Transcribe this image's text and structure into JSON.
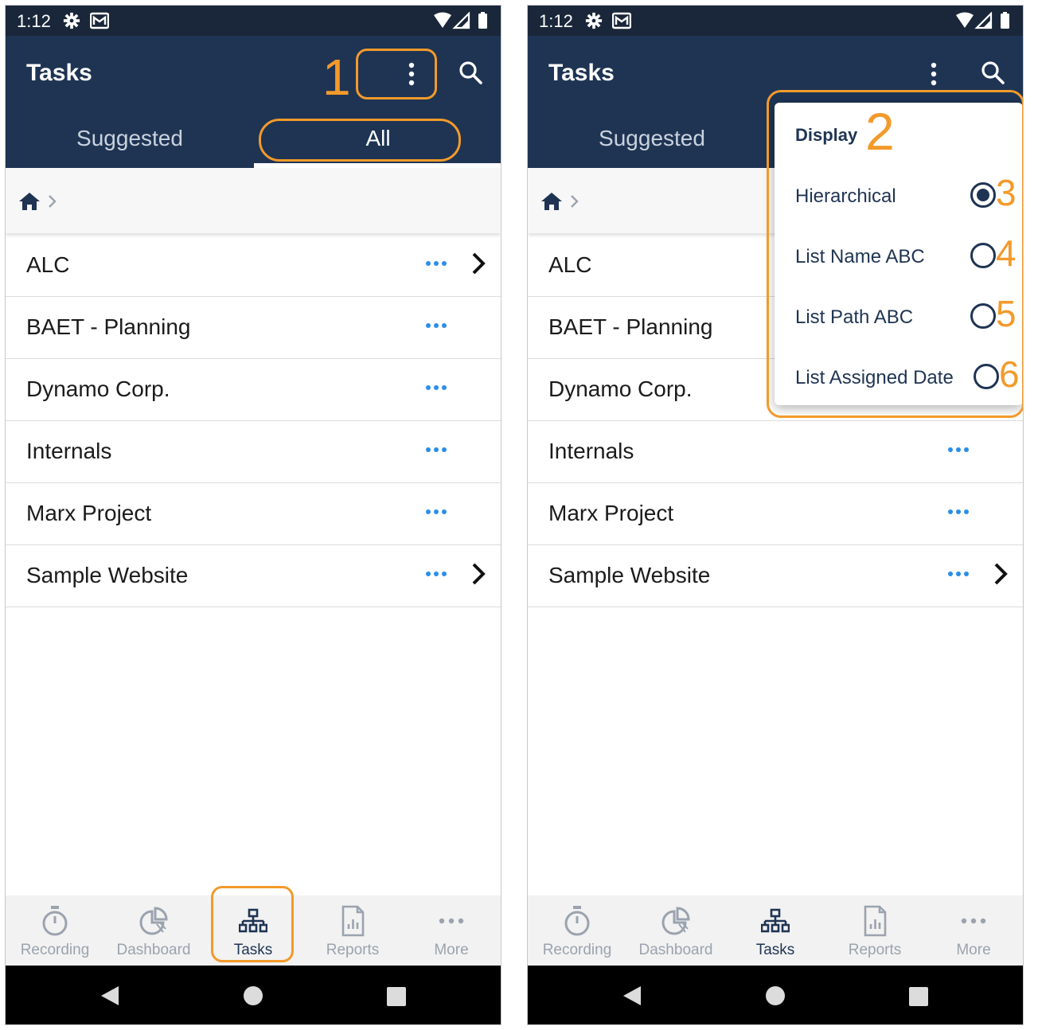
{
  "status_bar": {
    "time": "1:12"
  },
  "app_bar": {
    "title": "Tasks"
  },
  "tabs": {
    "suggested": "Suggested",
    "all": "All"
  },
  "task_list": [
    "ALC",
    "BAET - Planning",
    "Dynamo Corp.",
    "Internals",
    "Marx Project",
    "Sample Website"
  ],
  "bottom_nav": {
    "recording": "Recording",
    "dashboard": "Dashboard",
    "tasks": "Tasks",
    "reports": "Reports",
    "more": "More"
  },
  "display_menu": {
    "header": "Display",
    "options": [
      "Hierarchical",
      "List Name ABC",
      "List Path ABC",
      "List Assigned Date"
    ],
    "selected": "Hierarchical"
  },
  "callouts": {
    "c1": "1",
    "c2": "2",
    "c3": "3",
    "c4": "4",
    "c5": "5",
    "c6": "6"
  },
  "colors": {
    "appbar": "#1f3453",
    "statusbar": "#1a273a",
    "accent_dots": "#2b8ee8",
    "callout": "#f39a2b"
  },
  "icons": [
    "gear-icon",
    "mail-icon",
    "wifi-icon",
    "signal-icon",
    "battery-icon",
    "more-vert-icon",
    "search-icon",
    "home-icon",
    "chevron-right-icon",
    "more-horiz-icon",
    "stopwatch-icon",
    "pie-chart-icon",
    "hierarchy-icon",
    "report-icon",
    "back-icon",
    "home-circle-icon",
    "recents-icon"
  ]
}
